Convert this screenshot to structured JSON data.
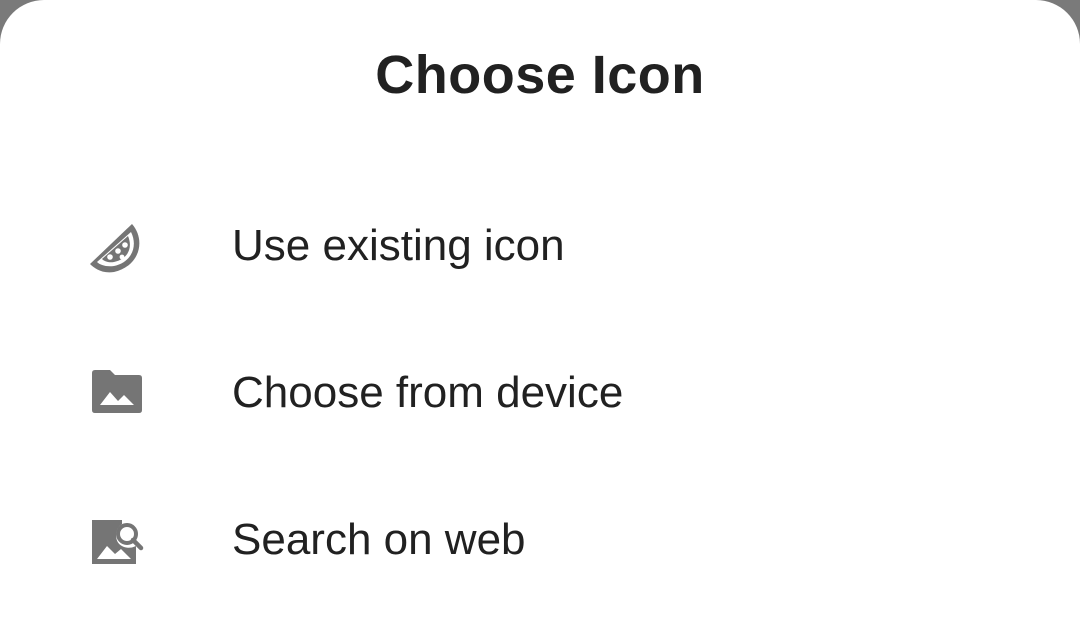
{
  "dialog": {
    "title": "Choose Icon",
    "options": [
      {
        "label": "Use existing icon",
        "icon": "watermelon-icon"
      },
      {
        "label": "Choose from device",
        "icon": "image-folder-icon"
      },
      {
        "label": "Search on web",
        "icon": "image-search-icon"
      }
    ]
  },
  "colors": {
    "icon": "#757575",
    "text": "#212121",
    "sheet_background": "#ffffff",
    "scrim": "#7a7a7a"
  }
}
